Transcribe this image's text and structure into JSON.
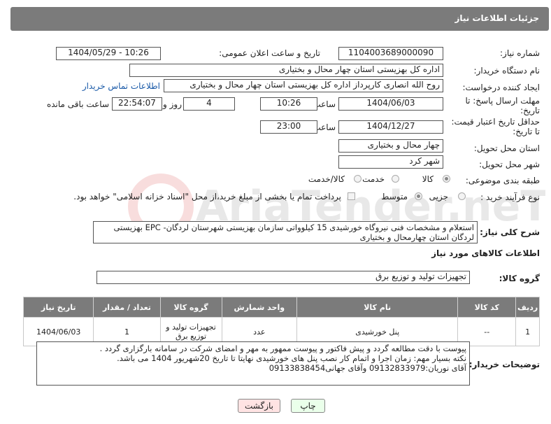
{
  "header": {
    "title": "جزئیات اطلاعات نیاز"
  },
  "fields": {
    "need_number_label": "شماره نیاز:",
    "need_number": "1104003689000090",
    "announce_label": "تاریخ و ساعت اعلان عمومی:",
    "announce_value": "1404/05/29 - 10:26",
    "buyer_org_label": "نام دستگاه خریدار:",
    "buyer_org": "اداره کل بهزیستی استان چهار محال و بختیاری",
    "requester_label": "ایجاد کننده درخواست:",
    "requester": "روح الله انصاری کارپرداز اداره کل بهزیستی استان چهار محال و بختیاری",
    "contact_link": "اطلاعات تماس خریدار",
    "deadline_label_1": "مهلت ارسال پاسخ: تا",
    "deadline_label_2": "تاریخ:",
    "deadline_date": "1404/06/03",
    "deadline_time_label": "ساعت",
    "deadline_time": "10:26",
    "days_count": "4",
    "days_label": "روز و",
    "remaining_time": "22:54:07",
    "remaining_label": "ساعت باقی مانده",
    "price_valid_label_1": "حداقل تاریخ اعتبار قیمت:",
    "price_valid_label_2": "تا تاریخ:",
    "price_valid_date": "1404/12/27",
    "price_valid_time_label": "ساعت",
    "price_valid_time": "23:00",
    "province_label": "استان محل تحویل:",
    "province": "چهار محال و بختیاری",
    "city_label": "شهر محل تحویل:",
    "city": "شهر کرد",
    "category_label": "طبقه بندی موضوعی:",
    "category_options": [
      "کالا",
      "خدمت",
      "کالا/خدمت"
    ],
    "process_label": "نوع فرآیند خرید :",
    "process_options": [
      "جزیی",
      "متوسط"
    ],
    "payment_note": "پرداخت تمام یا بخشی از مبلغ خرید،از محل \"اسناد خزانه اسلامی\" خواهد بود.",
    "description_label": "شرح کلی نیاز:",
    "description": "استعلام و مشخصات فنی نیروگاه خورشیدی 15 کیلوواتی سازمان بهزیستی شهرستان لردگان- EPC بهزیستی لردگان استان چهارمحال و بختیاری"
  },
  "goods_section": {
    "title": "اطلاعات کالاهای مورد نیاز",
    "group_label": "گروه کالا:",
    "group_value": "تجهیزات تولید و توزیع برق"
  },
  "table": {
    "headers": [
      "ردیف",
      "کد کالا",
      "نام کالا",
      "واحد شمارش",
      "گروه کالا",
      "تعداد / مقدار",
      "تاریخ نیاز"
    ],
    "rows": [
      [
        "1",
        "--",
        "پنل خورشیدی",
        "عدد",
        "تجهیزات تولید و توزیع برق",
        "1",
        "1404/06/03"
      ]
    ]
  },
  "buyer_notes": {
    "label": "توضیحات خریدار:",
    "lines": [
      "پیوست با دقت مطالعه گردد و پیش فاکتور و پیوست ممهور به مهر و امضای شرکت در سامانه بارگزاری گردد .",
      "نکته بسیار مهم: زمان اجرا و اتمام کار نصب پنل های خورشیدی نهایتا تا تاریخ 20شهریور 1404 می باشد.",
      "آقای نوریان:09132833979 وآقای جهانی09133838454"
    ]
  },
  "buttons": {
    "print": "چاپ",
    "back": "بازگشت"
  },
  "watermark": {
    "text": "AriaTender.neT"
  },
  "colors": {
    "header_bg": "#7b7b7b",
    "link": "#1a5aa8",
    "print_btn": "#eaffea",
    "back_btn": "#ffe3e3"
  }
}
